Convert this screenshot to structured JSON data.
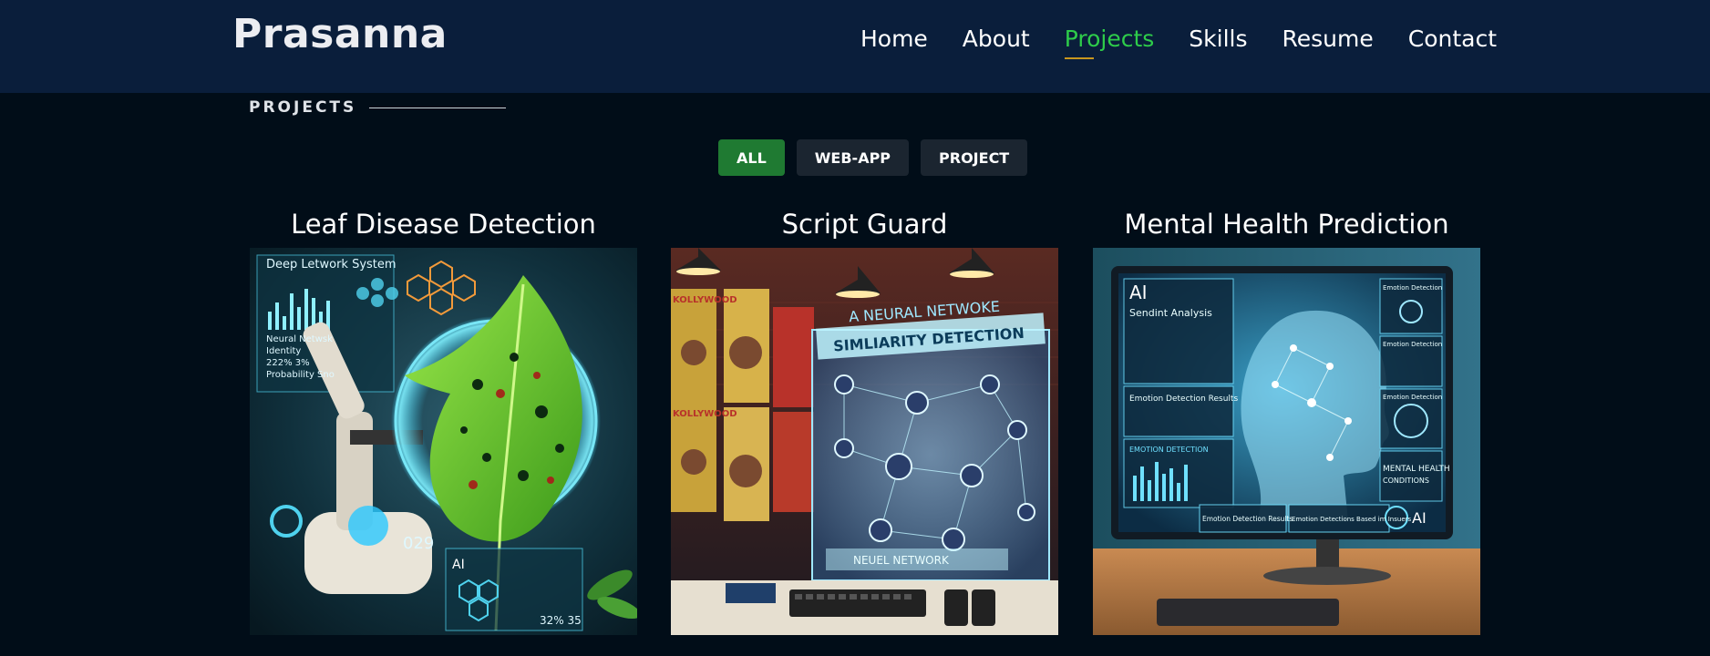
{
  "header": {
    "logo": "Prasanna",
    "nav": [
      {
        "label": "Home",
        "active": false
      },
      {
        "label": "About",
        "active": false
      },
      {
        "label": "Projects",
        "active": true
      },
      {
        "label": "Skills",
        "active": false
      },
      {
        "label": "Resume",
        "active": false
      },
      {
        "label": "Contact",
        "active": false
      }
    ]
  },
  "section": {
    "label": "PROJECTS"
  },
  "filters": [
    {
      "label": "ALL",
      "active": true
    },
    {
      "label": "WEB-APP",
      "active": false
    },
    {
      "label": "PROJECT",
      "active": false
    }
  ],
  "projects": [
    {
      "title": "Leaf Disease Detection",
      "image_text": {
        "panel_title": "Deep Letwork System",
        "panel_line1": "Neural Netwsk",
        "panel_line2": "Identity",
        "panel_line3": "222% 3%",
        "panel_line4": "Probability Sno",
        "readout": "029",
        "ai_label": "AI",
        "percent": "32%   35"
      }
    },
    {
      "title": "Script Guard",
      "image_text": {
        "poster_label": "KOLLYWOOD",
        "banner_top": "A NEURAL NETWOKE",
        "banner_main": "SIMLIARITY DETECTION",
        "banner_bottom": "NEUEL NETWORK"
      }
    },
    {
      "title": "Mental Health Prediction",
      "image_text": {
        "ai_label": "AI",
        "sentiment": "Sendint Analysis",
        "emotion_results": "Emotion Detection Results",
        "emotion_detection": "EMOTION DETECTION",
        "side1": "Emotion Detection",
        "side2": "Emotion Detection",
        "side3": "Emotion Detection",
        "mental_health": "MENTAL HEALTH",
        "conditions": "CONDITIONS",
        "bottom1": "Emotion Detection Results",
        "bottom2": "Emotion Detections Based im Insuers",
        "ai_badge": "AI"
      }
    }
  ],
  "colors": {
    "header_bg": "#0a1e3b",
    "page_bg": "#010d18",
    "accent_green": "#2ecc4a",
    "active_filter": "#1f7a32"
  }
}
